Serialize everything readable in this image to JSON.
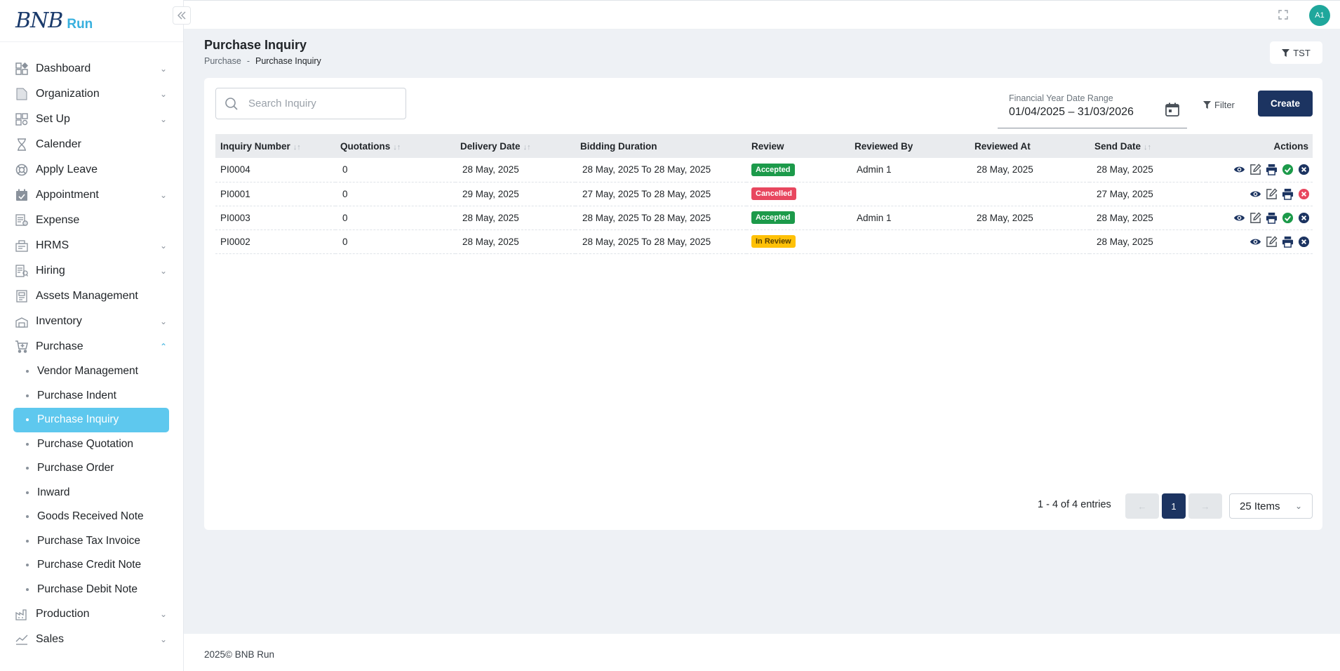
{
  "brand": {
    "logo_text": "BNB",
    "logo_sub": "Run"
  },
  "sidebar": {
    "items": [
      {
        "label": "Dashboard",
        "icon": "dashboard-icon",
        "has_children": true
      },
      {
        "label": "Organization",
        "icon": "file-icon",
        "has_children": true
      },
      {
        "label": "Set Up",
        "icon": "setup-icon",
        "has_children": true
      },
      {
        "label": "Calender",
        "icon": "hourglass-icon",
        "has_children": false
      },
      {
        "label": "Apply Leave",
        "icon": "lifebuoy-icon",
        "has_children": false
      },
      {
        "label": "Appointment",
        "icon": "calendar-check-icon",
        "has_children": true
      },
      {
        "label": "Expense",
        "icon": "expense-icon",
        "has_children": false
      },
      {
        "label": "HRMS",
        "icon": "hrms-icon",
        "has_children": true
      },
      {
        "label": "Hiring",
        "icon": "hiring-icon",
        "has_children": true
      },
      {
        "label": "Assets Management",
        "icon": "assets-icon",
        "has_children": false
      },
      {
        "label": "Inventory",
        "icon": "inventory-icon",
        "has_children": true
      },
      {
        "label": "Purchase",
        "icon": "cart-icon",
        "has_children": true,
        "expanded": true
      }
    ],
    "purchase_sub": [
      "Vendor Management",
      "Purchase Indent",
      "Purchase Inquiry",
      "Purchase Quotation",
      "Purchase Order",
      "Inward",
      "Goods Received Note",
      "Purchase Tax Invoice",
      "Purchase Credit Note",
      "Purchase Debit Note"
    ],
    "active_sub": "Purchase Inquiry",
    "items_after": [
      {
        "label": "Production",
        "icon": "production-icon",
        "has_children": true
      },
      {
        "label": "Sales",
        "icon": "sales-icon",
        "has_children": true
      }
    ]
  },
  "topbar": {
    "avatar_initials": "A1"
  },
  "header": {
    "title": "Purchase Inquiry",
    "breadcrumb_root": "Purchase",
    "breadcrumb_sep": "-",
    "breadcrumb_current": "Purchase Inquiry",
    "tst_label": "TST"
  },
  "toolbar": {
    "search_placeholder": "Search Inquiry",
    "date_range_label": "Financial Year Date Range",
    "date_range_value": "01/04/2025  – 31/03/2026",
    "filter_label": "Filter",
    "create_label": "Create"
  },
  "table": {
    "columns": [
      "Inquiry Number",
      "Quotations",
      "Delivery Date",
      "Bidding Duration",
      "Review",
      "Reviewed By",
      "Reviewed At",
      "Send Date",
      "Actions"
    ],
    "rows": [
      {
        "inquiry_number": "PI0004",
        "quotations": "0",
        "delivery_date": "28 May, 2025",
        "bidding_duration": "28 May, 2025 To 28 May, 2025",
        "review": "Accepted",
        "reviewed_by": "Admin 1",
        "reviewed_at": "28 May, 2025",
        "send_date": "28 May, 2025"
      },
      {
        "inquiry_number": "PI0001",
        "quotations": "0",
        "delivery_date": "29 May, 2025",
        "bidding_duration": "27 May, 2025 To 28 May, 2025",
        "review": "Cancelled",
        "reviewed_by": "",
        "reviewed_at": "",
        "send_date": "27 May, 2025"
      },
      {
        "inquiry_number": "PI0003",
        "quotations": "0",
        "delivery_date": "28 May, 2025",
        "bidding_duration": "28 May, 2025 To 28 May, 2025",
        "review": "Accepted",
        "reviewed_by": "Admin 1",
        "reviewed_at": "28 May, 2025",
        "send_date": "28 May, 2025"
      },
      {
        "inquiry_number": "PI0002",
        "quotations": "0",
        "delivery_date": "28 May, 2025",
        "bidding_duration": "28 May, 2025 To 28 May, 2025",
        "review": "In Review",
        "reviewed_by": "",
        "reviewed_at": "",
        "send_date": "28 May, 2025"
      }
    ]
  },
  "pagination": {
    "entries_text": "1 - 4 of 4 entries",
    "prev_label": "←",
    "current_page": "1",
    "next_label": "→",
    "page_size": "25 Items"
  },
  "footer": {
    "text": "2025© BNB Run"
  },
  "colors": {
    "primary": "#1c3461",
    "active_nav": "#5ec8ee",
    "accepted": "#1c9a4a",
    "cancelled": "#e8475f",
    "in_review": "#ffc107"
  }
}
